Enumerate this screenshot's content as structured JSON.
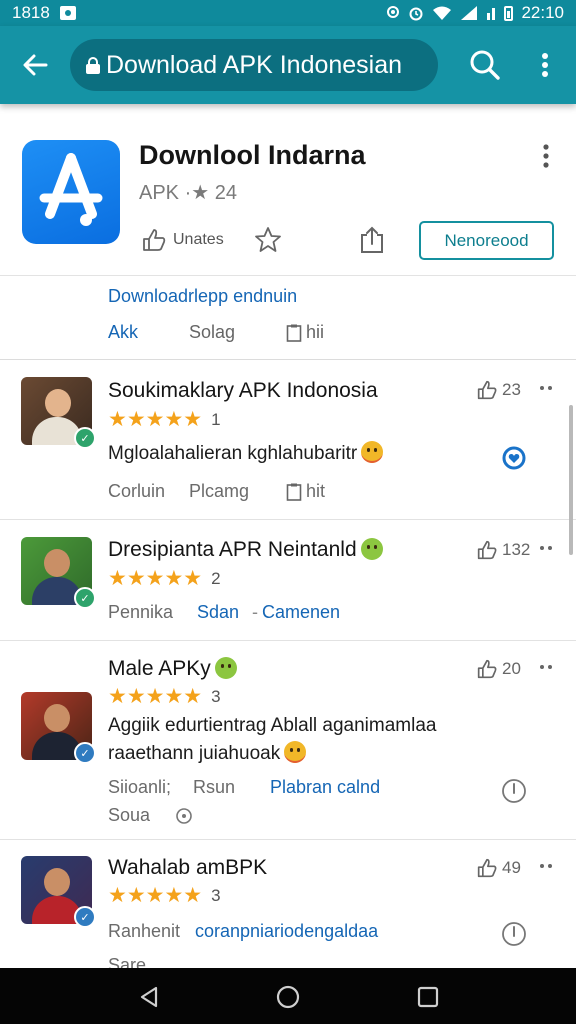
{
  "status_bar": {
    "time_left": "1818",
    "time_right": "22:10"
  },
  "app_bar": {
    "url_text": "Download APK Indonesian"
  },
  "app_header": {
    "title": "Downlool Indarna",
    "meta": "APK ·★ 24",
    "share_label": "Unates",
    "install_label": "Nenoreood"
  },
  "info": {
    "link_text": "Downloadrlepp endnuin",
    "tab_1": "Akk",
    "tab_2": "Solag",
    "tab_3": "hii"
  },
  "reviews": [
    {
      "title": "Soukimaklary APK Indonosia",
      "stars": "★★★★★",
      "rating_count": "1",
      "body_1": "Mgloalahalieran kghlahubaritr",
      "body_2": "",
      "likes": "23",
      "foot_1": "Corluin",
      "foot_2": "Plcamg",
      "foot_3": "hit",
      "foot_4": ""
    },
    {
      "title": "Dresipianta APR Neintanld",
      "stars": "★★★★★",
      "rating_count": "2",
      "body_1": "",
      "body_2": "",
      "likes": "132",
      "foot_1": "Pennika",
      "foot_2": "Sdan",
      "foot_3": "Camenen",
      "foot_4": ""
    },
    {
      "title": "Male APKy",
      "stars": "★★★★★",
      "rating_count": "3",
      "body_1": "Aggiik edurtientrag Ablall aganimamlaa",
      "body_2": "raaethann juiahuoak",
      "likes": "20",
      "foot_1": "Siioanli;",
      "foot_2": "Rsun",
      "foot_3": "Plabran calnd",
      "foot_4": "Soua"
    },
    {
      "title": "Wahalab amBPK",
      "stars": "★★★★★",
      "rating_count": "3",
      "body_1": "",
      "body_2": "",
      "likes": "49",
      "foot_1": "Ranhenit",
      "foot_2": "coranpniariodengaldaa",
      "foot_3": "Sare",
      "foot_4": ""
    }
  ],
  "colors": {
    "status_bar": "#0f8a9c",
    "app_bar": "#1593a5",
    "url_pill": "#0c6f80",
    "link": "#1566b5",
    "star": "#f4a21b",
    "nav_bar": "#050505"
  }
}
